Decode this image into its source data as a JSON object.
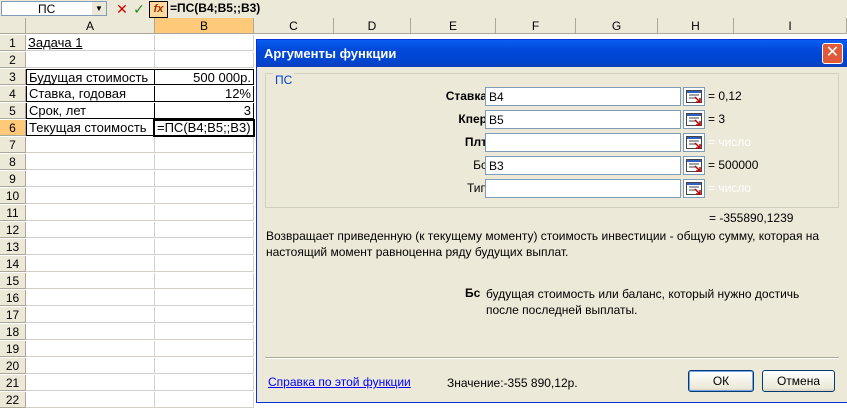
{
  "formula_bar": {
    "name_box": "ПС",
    "cancel_glyph": "✕",
    "enter_glyph": "✓",
    "fx_glyph": "fx",
    "formula": "=ПС(B4;B5;;B3)"
  },
  "sheet": {
    "columns": [
      "A",
      "B",
      "C",
      "D",
      "E",
      "F",
      "G",
      "H",
      "I"
    ],
    "rows": [
      "1",
      "2",
      "3",
      "4",
      "5",
      "6",
      "7",
      "8",
      "9",
      "10",
      "11",
      "12",
      "13",
      "14",
      "15",
      "16",
      "17",
      "18",
      "19",
      "20",
      "21",
      "22"
    ],
    "cells": {
      "A1": "Задача 1",
      "A3": "Будущая стоимость",
      "B3": "500 000р.",
      "A4": "Ставка, годовая",
      "B4": "12%",
      "A5": "Срок, лет",
      "B5": "3",
      "A6": "Текущая стоимость",
      "B6": "=ПС(B4;B5;;B3)"
    }
  },
  "dialog": {
    "title": "Аргументы функции",
    "close_glyph": "✕",
    "function_name": "ПС",
    "arguments": [
      {
        "label": "Ставка",
        "value": "B4",
        "result": "= 0,12"
      },
      {
        "label": "Кпер",
        "value": "B5",
        "result": "= 3"
      },
      {
        "label": "Плт",
        "value": "",
        "result": "= число"
      },
      {
        "label": "Бс",
        "value": "B3",
        "result": "= 500000"
      },
      {
        "label": "Тип",
        "value": "",
        "result": "= число"
      }
    ],
    "total_result": "= -355890,1239",
    "description": "Возвращает приведенную (к текущему моменту) стоимость инвестиции - общую сумму, которая на настоящий момент равноценна ряду будущих выплат.",
    "arg_desc_name": "Бс",
    "arg_desc_text": "будущая стоимость или баланс, который нужно достичь после последней выплаты.",
    "help_link": "Справка по этой функции",
    "value_label": "Значение:",
    "value": "-355 890,12р.",
    "ok_label": "ОК",
    "cancel_label": "Отмена"
  },
  "colors": {
    "titlebar": "#0a5ef0",
    "header_active": "#ffc97a",
    "dialog_bg": "#ece9d8",
    "link": "#0000ff"
  }
}
